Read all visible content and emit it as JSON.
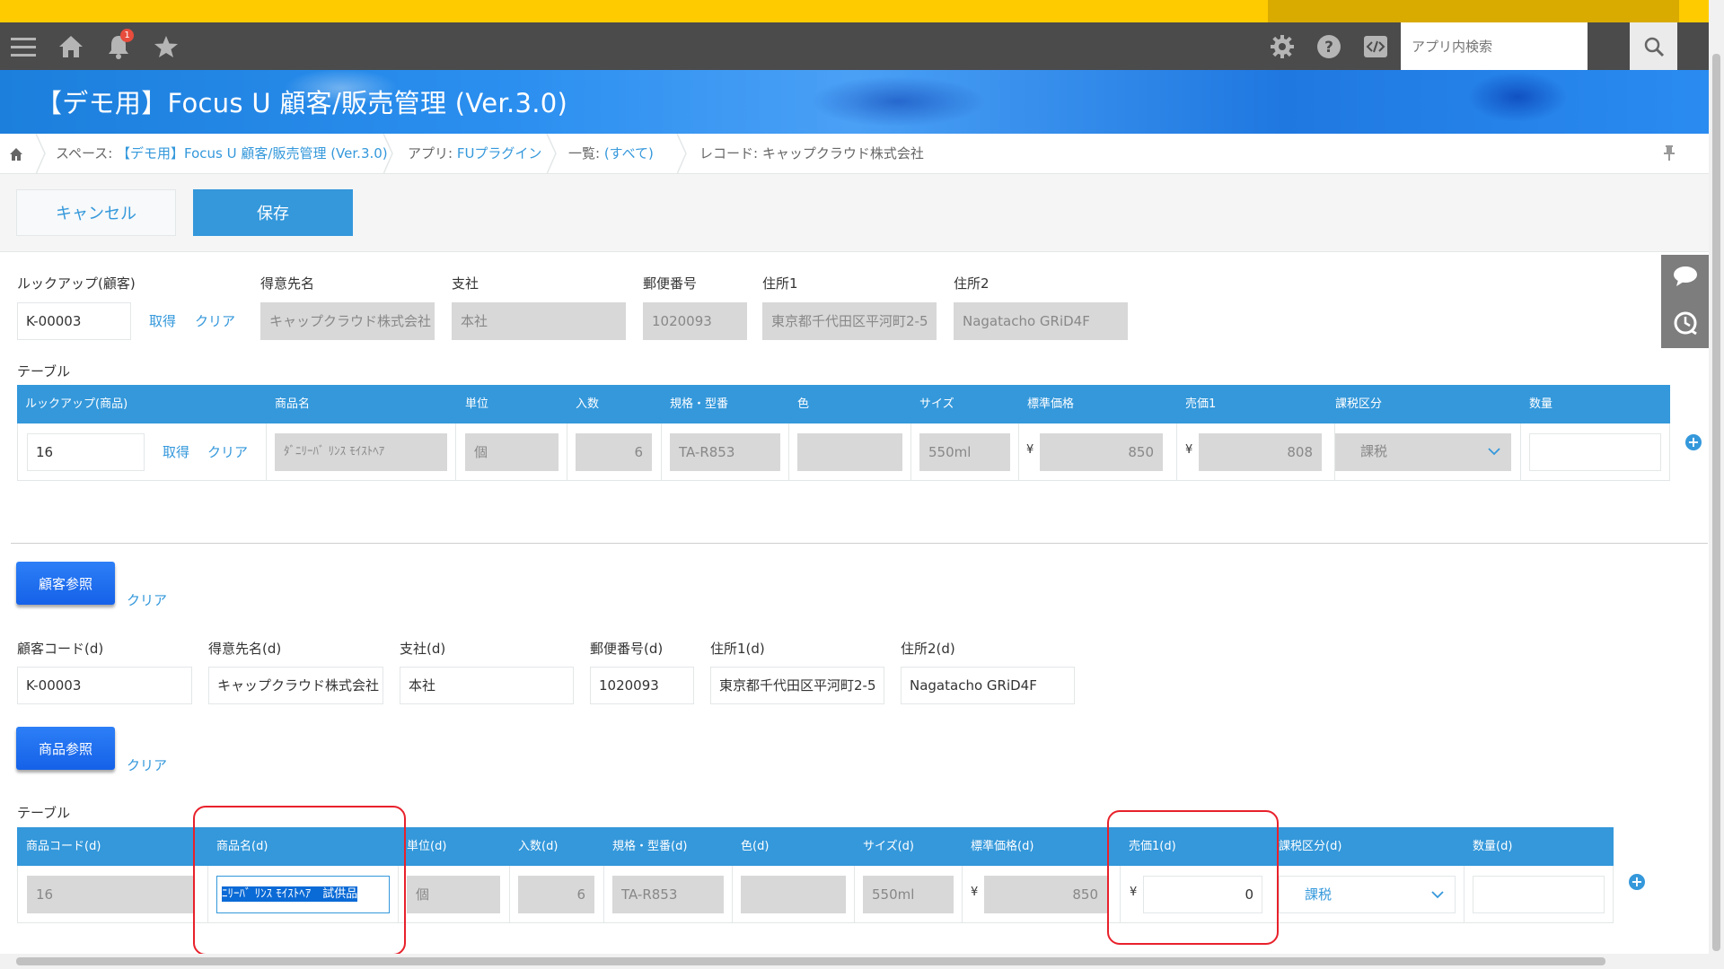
{
  "app": {
    "title": "【デモ用】Focus U 顧客/販売管理 (Ver.3.0)",
    "notification_count": "1",
    "search_placeholder": "アプリ内検索"
  },
  "breadcrumb": {
    "space_prefix": "スペース: ",
    "space_link": "【デモ用】Focus U 顧客/販売管理 (Ver.3.0)",
    "app_prefix": "アプリ: ",
    "app_link": "FUプラグイン",
    "list_prefix": "一覧: ",
    "list_link": "(すべて)",
    "record": "レコード: キャップクラウド株式会社"
  },
  "actions": {
    "cancel": "キャンセル",
    "save": "保存"
  },
  "lookup_section": {
    "lookup_label": "ルックアップ(顧客)",
    "lookup_value": "K-00003",
    "get": "取得",
    "clear": "クリア",
    "fields": [
      {
        "label": "得意先名",
        "value": "キャップクラウド株式会社"
      },
      {
        "label": "支社",
        "value": "本社"
      },
      {
        "label": "郵便番号",
        "value": "1020093"
      },
      {
        "label": "住所1",
        "value": "東京都千代田区平河町2-5"
      },
      {
        "label": "住所2",
        "value": "Nagatacho GRiD4F"
      }
    ]
  },
  "table1": {
    "title": "テーブル",
    "headers": [
      "ルックアップ(商品)",
      "商品名",
      "単位",
      "入数",
      "規格・型番",
      "色",
      "サイズ",
      "標準価格",
      "売価1",
      "課税区分",
      "数量"
    ],
    "row": {
      "lookup": "16",
      "get": "取得",
      "clear": "クリア",
      "product": "ﾀﾞﾆﾘｰﾊﾞ ﾘﾝｽ ﾓｲｽﾄﾍｱ",
      "unit": "個",
      "qty_per": "6",
      "model": "TA-R853",
      "color": "",
      "size": "550ml",
      "yen": "¥",
      "std_price": "850",
      "price1": "808",
      "tax": "課税",
      "quantity": ""
    }
  },
  "customer_ref": {
    "button": "顧客参照",
    "clear": "クリア",
    "fields": [
      {
        "label": "顧客コード(d)",
        "value": "K-00003"
      },
      {
        "label": "得意先名(d)",
        "value": "キャップクラウド株式会社"
      },
      {
        "label": "支社(d)",
        "value": "本社"
      },
      {
        "label": "郵便番号(d)",
        "value": "1020093"
      },
      {
        "label": "住所1(d)",
        "value": "東京都千代田区平河町2-5"
      },
      {
        "label": "住所2(d)",
        "value": "Nagatacho GRiD4F"
      }
    ]
  },
  "product_ref": {
    "button": "商品参照",
    "clear": "クリア"
  },
  "table2": {
    "title": "テーブル",
    "headers": [
      "商品コード(d)",
      "商品名(d)",
      "単位(d)",
      "入数(d)",
      "規格・型番(d)",
      "色(d)",
      "サイズ(d)",
      "標準価格(d)",
      "売価1(d)",
      "課税区分(d)",
      "数量(d)"
    ],
    "row": {
      "code": "16",
      "product": "ﾆﾘｰﾊﾞ ﾘﾝｽ ﾓｲｽﾄﾍｱ　試供品",
      "unit": "個",
      "qty_per": "6",
      "model": "TA-R853",
      "color": "",
      "size": "550ml",
      "yen": "¥",
      "std_price": "850",
      "price1": "0",
      "tax": "課税",
      "quantity": ""
    }
  },
  "colors": {
    "primary": "#3498db",
    "highlight": "#e8212b",
    "toolbar": "#4b4b4b",
    "topbar": "#fecb00"
  },
  "icons": [
    "menu-icon",
    "home-icon",
    "bell-icon",
    "star-icon",
    "gear-icon",
    "help-icon",
    "code-icon",
    "search-icon",
    "comment-icon",
    "history-icon",
    "pin-icon",
    "chevron-down-icon",
    "plus-icon"
  ]
}
